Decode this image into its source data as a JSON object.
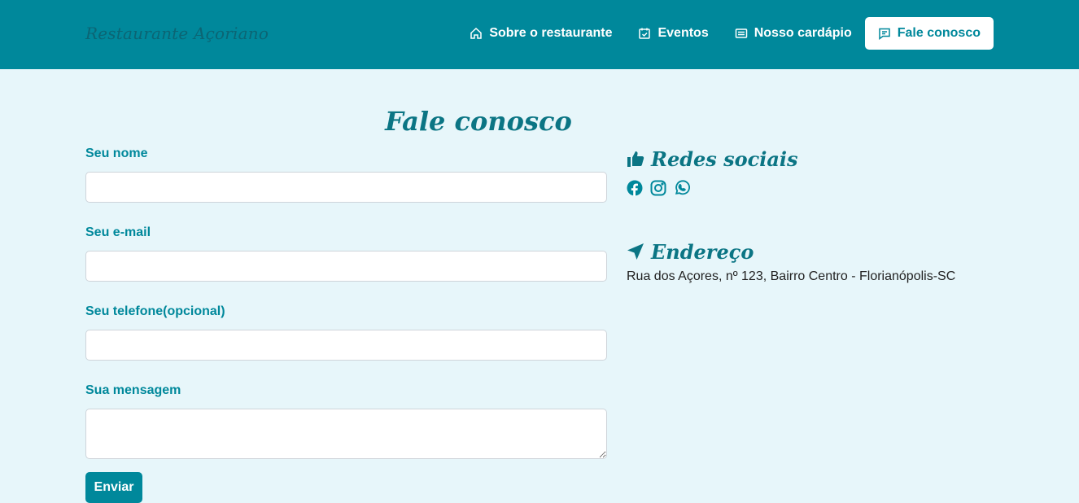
{
  "brand": "Restaurante Açoriano",
  "nav": {
    "items": [
      {
        "label": "Sobre o restaurante",
        "icon": "home-icon"
      },
      {
        "label": "Eventos",
        "icon": "calendar-check-icon"
      },
      {
        "label": "Nosso cardápio",
        "icon": "menu-list-icon"
      },
      {
        "label": "Fale conosco",
        "icon": "chat-icon",
        "active": true
      }
    ]
  },
  "page_title": "Fale conosco",
  "form": {
    "name_label": "Seu nome",
    "name_value": "",
    "email_label": "Seu e-mail",
    "email_value": "",
    "phone_label": "Seu telefone(opcional)",
    "phone_value": "",
    "message_label": "Sua mensagem",
    "message_value": "",
    "submit_label": "Enviar"
  },
  "social": {
    "heading": "Redes sociais",
    "icons": [
      "facebook-icon",
      "instagram-icon",
      "whatsapp-icon"
    ]
  },
  "address": {
    "heading": "Endereço",
    "text": "Rua dos Açores, nº 123, Bairro Centro - Florianópolis-SC"
  },
  "colors": {
    "primary": "#00889b",
    "heading": "#0b7584",
    "background": "#e7f6fa",
    "brand_text": "#0b6574"
  }
}
